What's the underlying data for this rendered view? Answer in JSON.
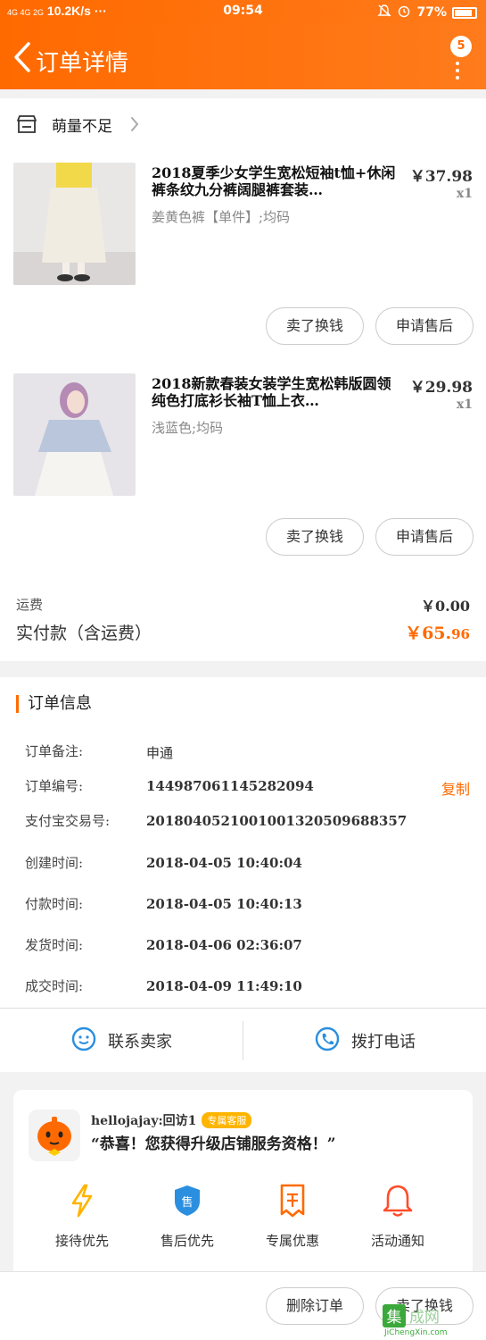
{
  "status_bar": {
    "network": "4G 4G 2G",
    "speed": "10.2K/s ···",
    "time": "09:54",
    "battery": "77%"
  },
  "header": {
    "title": "订单详情",
    "badge_count": "5"
  },
  "shop": {
    "name": "萌量不足"
  },
  "items": [
    {
      "title": "2018夏季少女学生宽松短袖t恤+休闲裤条纹九分裤阔腿裤套装…",
      "spec": "姜黄色裤【单件】;均码",
      "price": "￥37.98",
      "qty": "x1",
      "btn_sell": "卖了换钱",
      "btn_after_sale": "申请售后"
    },
    {
      "title": "2018新款春装女装学生宽松韩版圆领纯色打底衫长袖T恤上衣…",
      "spec": "浅蓝色;均码",
      "price": "￥29.98",
      "qty": "x1",
      "btn_sell": "卖了换钱",
      "btn_after_sale": "申请售后"
    }
  ],
  "summary": {
    "shipping_label": "运费",
    "shipping_value": "￥0.00",
    "paid_label": "实付款（含运费）",
    "paid_value_main": "￥65.",
    "paid_value_cents": "96"
  },
  "order_info": {
    "title": "订单信息",
    "rows": [
      {
        "label": "订单备注:",
        "value": "申通"
      },
      {
        "label": "订单编号:",
        "value": "144987061145282094"
      },
      {
        "label": "支付宝交易号:",
        "value": "2018040521001001320509688357"
      },
      {
        "label": "创建时间:",
        "value": "2018-04-05 10:40:04"
      },
      {
        "label": "付款时间:",
        "value": "2018-04-05 10:40:13"
      },
      {
        "label": "发货时间:",
        "value": "2018-04-06 02:36:07"
      },
      {
        "label": "成交时间:",
        "value": "2018-04-09 11:49:10"
      }
    ],
    "copy_label": "复制"
  },
  "contact": {
    "seller": "联系卖家",
    "call": "拨打电话"
  },
  "vip": {
    "user": "hellojajay:回访1",
    "tag": "专属客服",
    "message": "“恭喜！您获得升级店铺服务资格！”",
    "benefits": [
      "接待优先",
      "售后优先",
      "专属优惠",
      "活动通知"
    ],
    "colors": {
      "orange": "#ff6a00",
      "blue": "#2b8fe0"
    }
  },
  "bottom_bar": {
    "delete": "删除订单",
    "sell": "卖了换钱"
  },
  "watermark": {
    "text": "集成网",
    "url": "JiChengXin.com"
  }
}
